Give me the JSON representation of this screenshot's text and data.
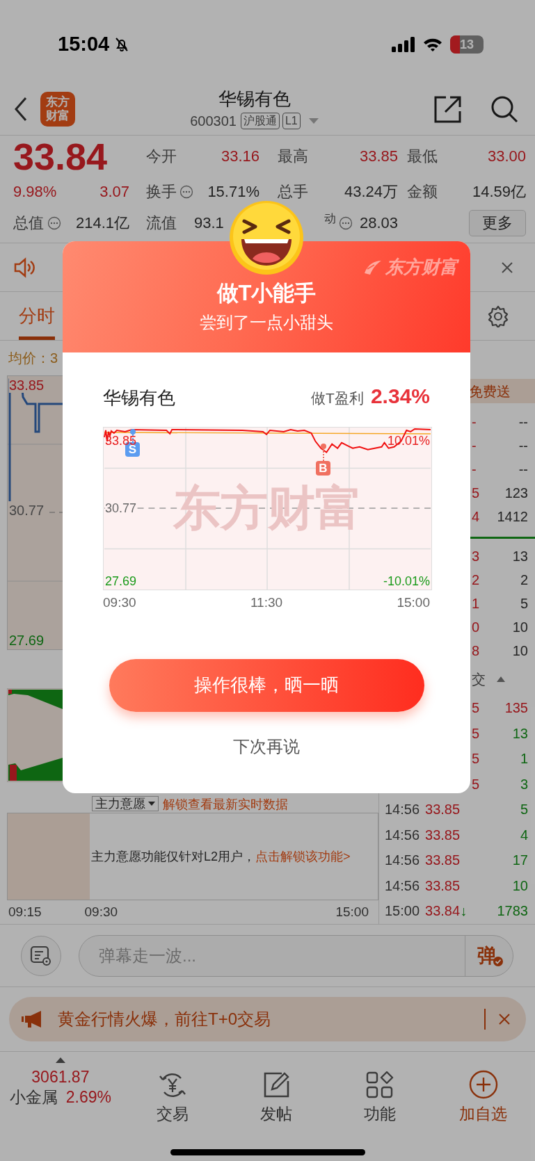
{
  "status_bar": {
    "time": "15:04",
    "battery": "13"
  },
  "header": {
    "logo": [
      "东方",
      "财富"
    ],
    "title": "华锡有色",
    "code": "600301",
    "tags": [
      "沪股通",
      "L1"
    ]
  },
  "quote": {
    "price": "33.84",
    "change_pct": "9.98%",
    "change": "3.07",
    "total_value": {
      "label": "总值",
      "value": "214.1亿",
      "info": true
    },
    "stats": [
      {
        "label": "今开",
        "value": "33.16",
        "info": false,
        "rising": true
      },
      {
        "label": "最高",
        "value": "33.85",
        "info": false,
        "rising": true
      },
      {
        "label": "最低",
        "value": "33.00",
        "info": false,
        "rising": true
      },
      {
        "label": "换手",
        "value": "15.71%",
        "info": true,
        "rising": false
      },
      {
        "label": "总手",
        "value": "43.24万",
        "info": false,
        "rising": false
      },
      {
        "label": "金额",
        "value": "14.59亿",
        "info": false,
        "rising": false
      },
      {
        "label": "流值",
        "value": "93.1",
        "info": false,
        "rising": false
      },
      {
        "label": "$^{动}$",
        "value": "28.03",
        "info": true,
        "rising": false
      }
    ],
    "more_button": "更多"
  },
  "tabs": [
    {
      "label": "分时",
      "selected": true
    }
  ],
  "intraday": {
    "avg_label": "均价：3",
    "high": "33.85",
    "mid": "30.77",
    "low": "27.69"
  },
  "main_force": {
    "title": "主力意愿",
    "link": "解锁查看最新实时数据",
    "notice": "主力意愿功能仅针对L2用户，",
    "notice_link": "点击解锁该功能>"
  },
  "time_axis": [
    "09:15",
    "09:30",
    "15:00"
  ],
  "order_book": {
    "promo": "免费送",
    "asks": [
      {
        "price": "-",
        "volume": "--"
      },
      {
        "price": "-",
        "volume": "--"
      },
      {
        "price": "-",
        "volume": "--"
      },
      {
        "price": "5",
        "volume": "123"
      },
      {
        "price": "4",
        "volume": "1412"
      }
    ],
    "bids": [
      {
        "price": "3",
        "volume": "13"
      },
      {
        "price": "2",
        "volume": "2"
      },
      {
        "price": "1",
        "volume": "5"
      },
      {
        "price": "0",
        "volume": "10"
      },
      {
        "price": "8",
        "volume": "10"
      }
    ]
  },
  "ticks": {
    "header": "交",
    "rows": [
      {
        "price": "5",
        "volume": "135",
        "buy": true
      },
      {
        "price": "5",
        "volume": "13",
        "buy": false
      },
      {
        "price": "5",
        "volume": "1",
        "buy": false
      },
      {
        "price": "5",
        "volume": "3",
        "buy": false
      },
      {
        "time": "14:56",
        "price": "33.85",
        "volume": "5",
        "buy": false
      },
      {
        "time": "14:56",
        "price": "33.85",
        "volume": "4",
        "buy": false
      },
      {
        "time": "14:56",
        "price": "33.85",
        "volume": "17",
        "buy": false
      },
      {
        "time": "14:56",
        "price": "33.85",
        "volume": "10",
        "buy": false
      },
      {
        "time": "15:00",
        "price": "33.84",
        "arrow": "↓",
        "volume": "1783",
        "buy": false
      }
    ]
  },
  "danmaku": {
    "placeholder": "弹幕走一波...",
    "send": "弹"
  },
  "banner": {
    "text": "黄金行情火爆，前往T+0交易"
  },
  "tab_bar": {
    "index": {
      "value": "3061.87",
      "name": "小金属",
      "change": "2.69%"
    },
    "items": [
      {
        "label": "交易",
        "kind": "trade",
        "highlight": false
      },
      {
        "label": "发帖",
        "kind": "post",
        "highlight": false
      },
      {
        "label": "功能",
        "kind": "apps",
        "highlight": false
      },
      {
        "label": "加自选",
        "kind": "add",
        "highlight": true
      }
    ]
  },
  "modal": {
    "brand": "东方财富",
    "title": "做T小能手",
    "subtitle": "尝到了一点小甜头",
    "stock": "华锡有色",
    "profit_label": "做T盈利",
    "profit": "2.34%",
    "chart": {
      "watermark": "东方财富",
      "high": "33.85",
      "high_pct": "10.01%",
      "mid": "30.77",
      "low": "27.69",
      "low_pct": "-10.01%",
      "sell_mark": "S",
      "buy_mark": "B",
      "times": [
        "09:30",
        "11:30",
        "15:00"
      ]
    },
    "primary_button": "操作很棒，晒一晒",
    "secondary_button": "下次再说"
  }
}
